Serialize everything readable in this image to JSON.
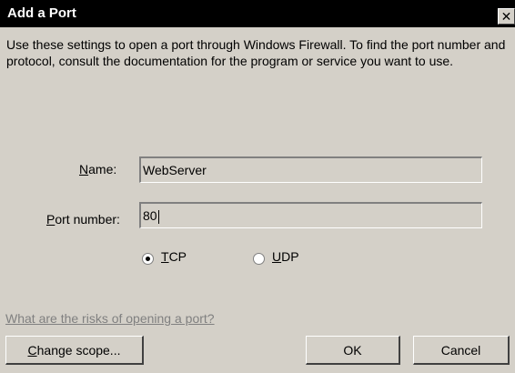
{
  "window": {
    "title": "Add a Port",
    "close_glyph": "✕"
  },
  "description": "Use these settings to open a port through Windows Firewall. To find the port number and protocol, consult the documentation for the program or service you want to use.",
  "name_field": {
    "label_accel": "N",
    "label_rest": "ame:",
    "value": "WebServer"
  },
  "port_field": {
    "label_accel": "P",
    "label_rest": "ort number:",
    "value": "80"
  },
  "protocol": {
    "selected": "TCP",
    "tcp": {
      "accel": "T",
      "rest": "CP"
    },
    "udp": {
      "accel": "U",
      "rest": "DP"
    }
  },
  "risks_link": "What are the risks of opening a port?",
  "buttons": {
    "change_scope": {
      "accel": "C",
      "rest": "hange scope..."
    },
    "ok": "OK",
    "cancel": "Cancel"
  }
}
